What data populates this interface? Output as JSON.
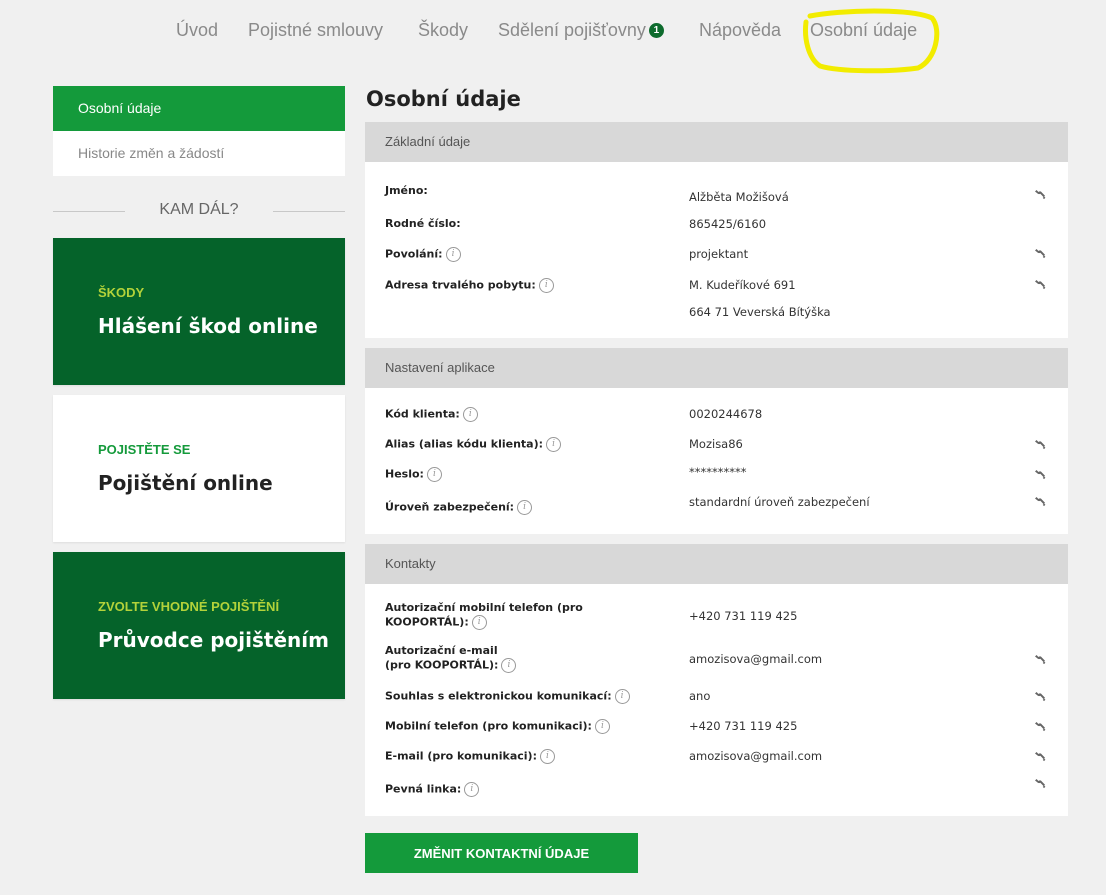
{
  "nav": {
    "items": [
      {
        "label": "Úvod"
      },
      {
        "label": "Pojistné smlouvy"
      },
      {
        "label": "Škody"
      },
      {
        "label": "Sdělení pojišťovny",
        "badge": "1"
      },
      {
        "label": "Nápověda"
      },
      {
        "label": "Osobní údaje"
      }
    ],
    "highlight_color": "#f2ec00"
  },
  "sidebar": {
    "menu": [
      {
        "label": "Osobní údaje",
        "active": true
      },
      {
        "label": "Historie změn a žádostí",
        "active": false
      }
    ],
    "kam_dal": "KAM DÁL?",
    "promos": [
      {
        "kicker": "ŠKODY",
        "title": "Hlášení škod online",
        "style": "dark"
      },
      {
        "kicker": "POJISTĚTE SE",
        "title": "Pojištění online",
        "style": "light"
      },
      {
        "kicker": "ZVOLTE VHODNÉ POJIŠTĚNÍ",
        "title": "Průvodce pojištěním",
        "style": "dark"
      }
    ]
  },
  "main": {
    "title": "Osobní údaje",
    "sections": [
      {
        "heading": "Základní údaje",
        "rows": [
          {
            "label": "Jméno:",
            "value": "Alžběta Možišová",
            "info": false,
            "edit": true
          },
          {
            "label": "Rodné číslo:",
            "value": "865425/6160",
            "info": false,
            "edit": false
          },
          {
            "label": "Povolání:",
            "value": "projektant",
            "info": true,
            "edit": true
          },
          {
            "label": "Adresa trvalého pobytu:",
            "value": "M. Kudeříkové 691",
            "value2": "664 71 Veverská Bítýška",
            "info": true,
            "edit": true
          }
        ]
      },
      {
        "heading": "Nastavení aplikace",
        "rows": [
          {
            "label": "Kód klienta:",
            "value": "0020244678",
            "info": true,
            "edit": false
          },
          {
            "label": "Alias (alias kódu klienta):",
            "value": "Mozisa86",
            "info": true,
            "edit": true
          },
          {
            "label": "Heslo:",
            "value": "**********",
            "info": true,
            "edit": true
          },
          {
            "label": "Úroveň zabezpečení:",
            "value": "standardní úroveň zabezpečení",
            "info": true,
            "edit": true
          }
        ]
      },
      {
        "heading": "Kontakty",
        "rows": [
          {
            "label": "Autorizační mobilní telefon (pro KOOPORTÁL):",
            "value": "+420 731 119 425",
            "info": true,
            "edit": false
          },
          {
            "label": "Autorizační e-mail (pro KOOPORTÁL):",
            "value": "amozisova@gmail.com",
            "info": true,
            "edit": true
          },
          {
            "label": "Souhlas s elektronickou komunikací:",
            "value": "ano",
            "info": true,
            "edit": true
          },
          {
            "label": "Mobilní telefon (pro komunikaci):",
            "value": "+420 731 119 425",
            "info": true,
            "edit": true
          },
          {
            "label": "E-mail (pro komunikaci):",
            "value": "amozisova@gmail.com",
            "info": true,
            "edit": true
          },
          {
            "label": "Pevná linka:",
            "value": "",
            "info": true,
            "edit": true
          }
        ]
      }
    ],
    "button_label": "ZMĚNIT KONTAKTNÍ ÚDAJE"
  },
  "colors": {
    "accent_green": "#149a3b",
    "dark_green": "#05632a",
    "lime": "#b3d23a"
  }
}
